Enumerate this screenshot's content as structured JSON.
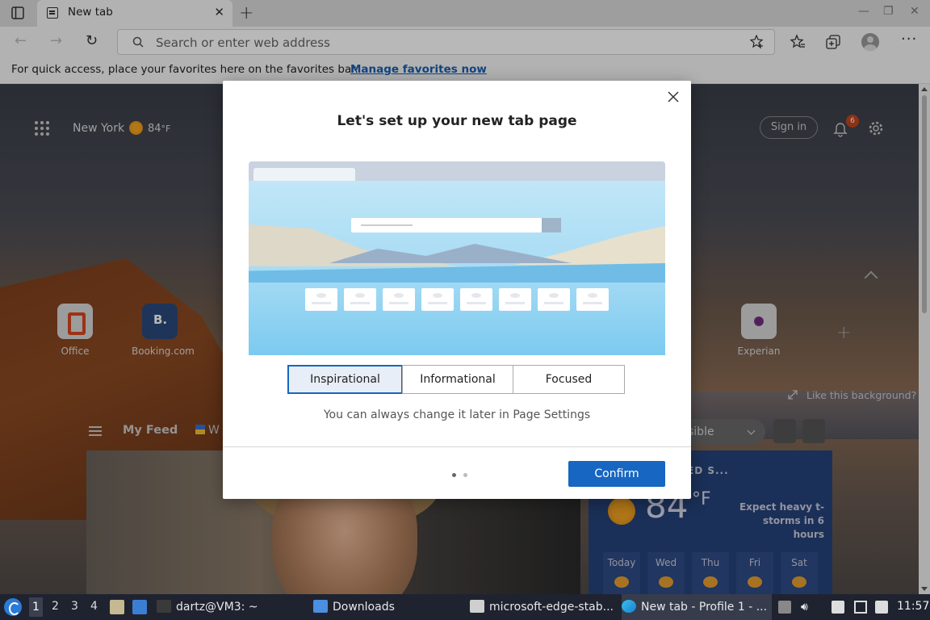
{
  "browser": {
    "tab_title": "New tab",
    "address_placeholder": "Search or enter web address",
    "favbar_message": "For quick access, place your favorites here on the favorites bar.",
    "favbar_link": "Manage favorites now"
  },
  "ntp": {
    "city": "New York",
    "temperature": "84",
    "temperature_unit": "°F",
    "sign_in": "Sign in",
    "notification_count": "6",
    "tiles": [
      {
        "label": "Office"
      },
      {
        "label": "Booking.com"
      },
      {
        "label": "Experian"
      }
    ],
    "like_background": "Like this background?",
    "feed_tab_my_feed": "My Feed",
    "feed_tab_second": "W",
    "visibility_select": "sible",
    "weather": {
      "card_title": "ED S...",
      "temp": "84",
      "unit": "°F",
      "alert": "Expect heavy t-storms in 6 hours",
      "days": [
        "Today",
        "Wed",
        "Thu",
        "Fri",
        "Sat"
      ]
    }
  },
  "dialog": {
    "title": "Let's set up your new tab page",
    "options": [
      "Inspirational",
      "Informational",
      "Focused"
    ],
    "selected_option": "Inspirational",
    "hint": "You can always change it later in Page Settings",
    "confirm_label": "Confirm",
    "page_indicator": {
      "current": 1,
      "total": 2
    }
  },
  "taskbar": {
    "workspaces": [
      "1",
      "2",
      "3",
      "4"
    ],
    "active_workspace": "1",
    "tasks": [
      {
        "label": "dartz@VM3: ~"
      },
      {
        "label": "Downloads"
      },
      {
        "label": "microsoft-edge-stab..."
      },
      {
        "label": "New tab - Profile 1 - ..."
      }
    ],
    "clock": "11:57"
  },
  "colors": {
    "accent": "#1766c1",
    "link": "#1a5fb4",
    "taskbar_bg": "#1f2330",
    "notification_badge": "#c4451c"
  },
  "icons": [
    "tab-actions-icon",
    "new-tab-favicon",
    "close-icon",
    "new-tab-plus-icon",
    "minimize-icon",
    "restore-icon",
    "window-close-icon",
    "back-icon",
    "forward-icon",
    "refresh-icon",
    "search-icon",
    "add-favorite-icon",
    "favorites-icon",
    "collections-icon",
    "profile-avatar",
    "more-icon",
    "apps-grid-icon",
    "weather-sun-icon",
    "bell-icon",
    "gear-icon",
    "expand-icon",
    "menu-icon"
  ]
}
